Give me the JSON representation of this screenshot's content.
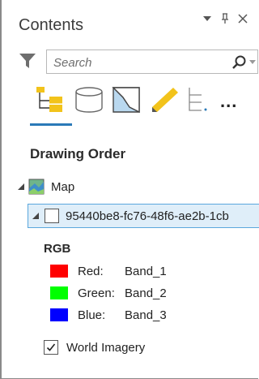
{
  "pane": {
    "title": "Contents",
    "buttons": {
      "menu_icon": "chevron-down-icon",
      "pin_icon": "pin-icon",
      "close_icon": "close-icon"
    }
  },
  "search": {
    "placeholder": "Search"
  },
  "view_tools": [
    {
      "name": "list-by-drawing-order-icon",
      "active": true
    },
    {
      "name": "list-by-source-icon",
      "active": false
    },
    {
      "name": "list-by-selection-icon",
      "active": false
    },
    {
      "name": "list-by-editing-icon",
      "active": false
    },
    {
      "name": "list-by-snapping-icon",
      "active": false
    }
  ],
  "more_label": "...",
  "tree": {
    "heading": "Drawing Order",
    "map": {
      "label": "Map"
    },
    "layer": {
      "label": "95440be8-fc76-48f6-ae2b-1cb",
      "checked": false,
      "renderer_label": "RGB",
      "bands": [
        {
          "channel": "Red:",
          "value": "Band_1",
          "color": "#ff0000"
        },
        {
          "channel": "Green:",
          "value": "Band_2",
          "color": "#00ff00"
        },
        {
          "channel": "Blue:",
          "value": "Band_3",
          "color": "#0000ff"
        }
      ]
    },
    "basemap": {
      "label": "World Imagery",
      "checked": true
    }
  },
  "colors": {
    "accent": "#2a7ab8",
    "selection_bg": "#dfeef9",
    "selection_border": "#5aa7dd"
  }
}
